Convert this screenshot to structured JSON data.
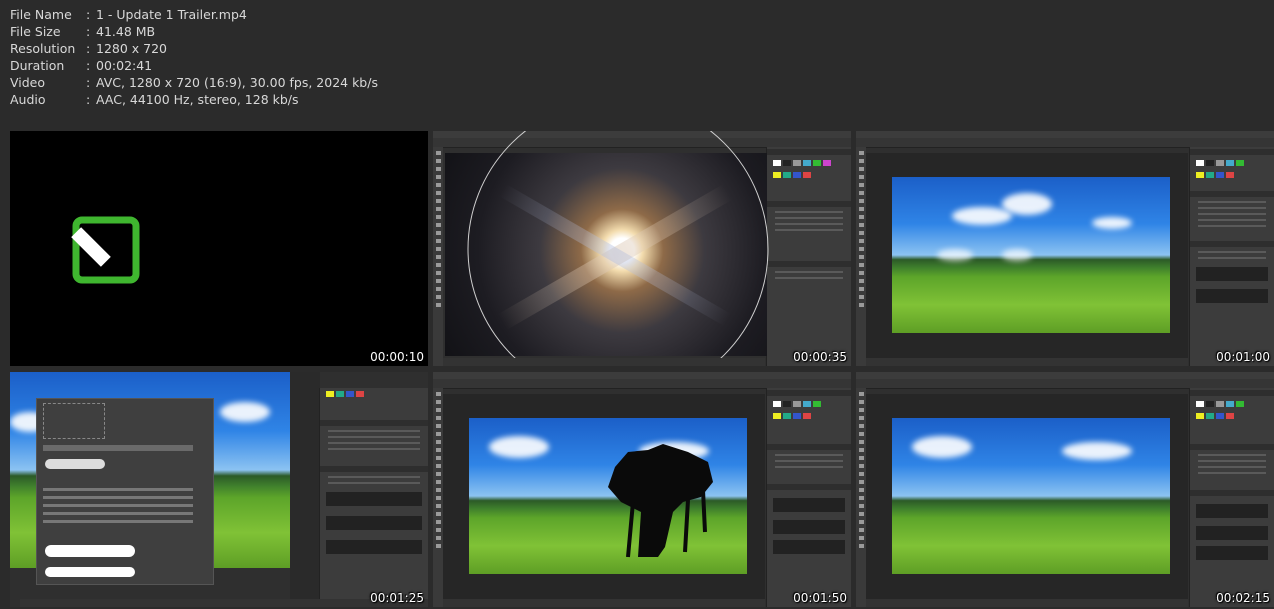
{
  "file_info": [
    {
      "label": "File Name",
      "value": "1 - Update 1 Trailer.mp4"
    },
    {
      "label": "File Size",
      "value": "41.48 MB"
    },
    {
      "label": "Resolution",
      "value": "1280 x 720"
    },
    {
      "label": "Duration",
      "value": "00:02:41"
    },
    {
      "label": "Video",
      "value": "AVC, 1280 x 720 (16:9), 30.00 fps, 2024 kb/s"
    },
    {
      "label": "Audio",
      "value": "AAC, 44100 Hz, stereo, 128 kb/s"
    }
  ],
  "separator": ":",
  "thumbnails": [
    {
      "timestamp": "00:00:10",
      "scene": "logo-intro"
    },
    {
      "timestamp": "00:00:35",
      "scene": "lens-flare-editing"
    },
    {
      "timestamp": "00:01:00",
      "scene": "landscape-with-clouds"
    },
    {
      "timestamp": "00:01:25",
      "scene": "brush-preset-panel"
    },
    {
      "timestamp": "00:01:50",
      "scene": "tree-brush-painting"
    },
    {
      "timestamp": "00:02:15",
      "scene": "clean-landscape"
    }
  ],
  "colors": {
    "background": "#2b2b2b",
    "text": "#d8d8d8",
    "logo_green": "#3fb62f",
    "ps_panel": "#3c3c3c"
  }
}
